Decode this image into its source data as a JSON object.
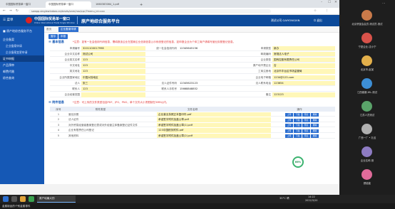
{
  "browser": {
    "tabs": [
      "中国国际贸易单一窗口",
      "中国国际贸易单一窗口",
      "1660383064_1.pdf"
    ],
    "new_tab": "+",
    "url": "swapp.singlewindow.cn/dzvds/onm/nav/cpr/?menu_id=xxx"
  },
  "app": {
    "menu_label": "菜单",
    "logo_cn": "中国国际贸易单一窗口",
    "logo_en": "China International Trade Single Window",
    "system_title": "原产地综合服务平台",
    "user_name": "测试公司 GAIYONGXIN",
    "logout": "退出"
  },
  "sidebar": {
    "root": "原产地综合服务平台",
    "items": [
      {
        "label": "企业备案",
        "level": 1,
        "selected": false
      },
      {
        "label": "企业备案申请",
        "level": 2,
        "selected": false
      },
      {
        "label": "企业备案变更申请",
        "level": 2,
        "selected": false
      },
      {
        "label": "证书申报",
        "level": 1,
        "selected": true
      },
      {
        "label": "产品预审",
        "level": 1,
        "selected": false
      },
      {
        "label": "邮费代缴",
        "level": 1,
        "selected": false
      },
      {
        "label": "综合查询",
        "level": 1,
        "selected": false
      }
    ]
  },
  "content": {
    "crumbs": [
      "首页",
      "企业备案申请"
    ],
    "toolbar": {
      "save": "暂存",
      "submit": "申报"
    },
    "basic_title": "基本信息",
    "basic_notice": "*注意：如有一社会信用代码信息，需填报该企业在国家企业信用信息公示系统登记的信息，如申报企业为个体工商户请填写营业执照登记信息。",
    "form_rows": [
      [
        "申请编号",
        "3201100017998",
        "统一社会信用代码",
        "12345645156",
        "申请类型",
        "新办"
      ],
      [
        "企业中文名称",
        "测试公司",
        "",
        "",
        "邮政编码",
        "常规法人电子"
      ],
      [
        "企业英文名称",
        "123",
        "",
        "",
        "企业类型",
        "国有控股有限责任公司"
      ],
      [
        "中文地址",
        "123",
        "",
        "",
        "原产地不是企业",
        "否"
      ],
      [
        "英文地址",
        "123",
        "",
        "",
        "工商注册地",
        "北京市丰台区市场监管局"
      ],
      [
        "企业所属国家地区",
        "中国大陆地区",
        "",
        "",
        "企业电子邮箱",
        "1234@123.com"
      ],
      [
        "法人",
        "张三",
        "法人证件号码",
        "12345623123",
        "法人联系电话",
        "123654"
      ],
      [
        "联系人",
        "123",
        "联系人手机号",
        "15668848852",
        "",
        ""
      ],
      [
        "企业经营范围",
        "",
        "",
        "",
        "备注",
        "123123"
      ]
    ],
    "attach_title": "附件信息",
    "attach_notice": "*注意：可上传的文件类型包括PDF、JPG、PNG，单个文件大小须限制在5MB以内。",
    "attach_headers": [
      "序号",
      "附件类型",
      "文件名称",
      "操作"
    ],
    "attachments": [
      {
        "no": "1",
        "type": "营业执照",
        "file": "企业营业执照正本复印件.pdf"
      },
      {
        "no": "2",
        "type": "法人证件",
        "file": "承诺签字附件加盖公章.pdf"
      },
      {
        "no": "3",
        "type": "对外贸易经营者备案登记表或对外经营主体备案登记证件文件",
        "file": "承诺签字附件加盖公章(1).pdf"
      },
      {
        "no": "4",
        "type": "企业有限责任公司登记",
        "file": "123中国税务附件.pdf"
      },
      {
        "no": "5",
        "type": "其他资料",
        "file": "承诺签字附件加盖公章(2).pdf"
      }
    ],
    "ops": [
      "上传",
      "下载",
      "预览",
      "删除"
    ],
    "progress_label": "66%",
    "progress_value": 0.66
  },
  "taskbar": {
    "task_label": "原产地最大的",
    "weather": "35°C 晴",
    "time": "14:22",
    "date": "2022/3/20"
  },
  "caption": "金属制品的个别金属零件",
  "participants": [
    {
      "name": "北京贸促会会员-测试员-测试",
      "color": "#c97a4a"
    },
    {
      "name": "宁夏企业-沈小宁",
      "color": "#d8524a"
    },
    {
      "name": "北京市-赵某",
      "color": "#e3b04b"
    },
    {
      "name": "江西客服-WL-测试",
      "color": "#3d8fd6"
    },
    {
      "name": "江苏人员测试",
      "color": "#5aa36a"
    },
    {
      "name": "广西一厂 • 孔佳",
      "color": "#b0b0b0"
    },
    {
      "name": "企业名称-测",
      "color": "#8e7cc3"
    },
    {
      "name": "顾能能",
      "color": "#e06b9a"
    }
  ]
}
